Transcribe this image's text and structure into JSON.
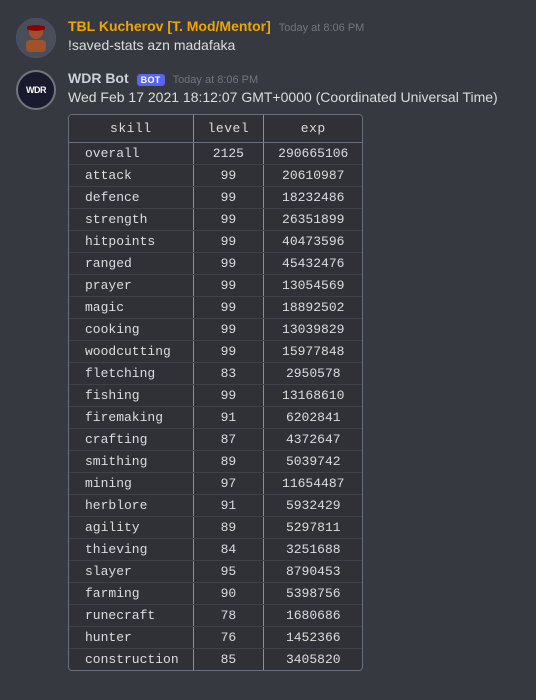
{
  "messages": [
    {
      "id": "msg1",
      "username": "TBL Kucherov [T. Mod/Mentor]",
      "username_color": "#f0a500",
      "timestamp": "Today at 8:06 PM",
      "text": "!saved-stats azn madafaka",
      "is_bot": false,
      "avatar_type": "tbl"
    },
    {
      "id": "msg2",
      "username": "WDR Bot",
      "timestamp": "Today at 8:06 PM",
      "text": "Wed Feb 17 2021 18:12:07 GMT+0000 (Coordinated Universal Time)",
      "is_bot": true,
      "avatar_type": "wdr",
      "time_label": "8:06 PM"
    }
  ],
  "bot_badge": "BOT",
  "table": {
    "headers": [
      "skill",
      "level",
      "exp"
    ],
    "rows": [
      [
        "overall",
        "2125",
        "290665106"
      ],
      [
        "attack",
        "99",
        "20610987"
      ],
      [
        "defence",
        "99",
        "18232486"
      ],
      [
        "strength",
        "99",
        "26351899"
      ],
      [
        "hitpoints",
        "99",
        "40473596"
      ],
      [
        "ranged",
        "99",
        "45432476"
      ],
      [
        "prayer",
        "99",
        "13054569"
      ],
      [
        "magic",
        "99",
        "18892502"
      ],
      [
        "cooking",
        "99",
        "13039829"
      ],
      [
        "woodcutting",
        "99",
        "15977848"
      ],
      [
        "fletching",
        "83",
        "2950578"
      ],
      [
        "fishing",
        "99",
        "13168610"
      ],
      [
        "firemaking",
        "91",
        "6202841"
      ],
      [
        "crafting",
        "87",
        "4372647"
      ],
      [
        "smithing",
        "89",
        "5039742"
      ],
      [
        "mining",
        "97",
        "11654487"
      ],
      [
        "herblore",
        "91",
        "5932429"
      ],
      [
        "agility",
        "89",
        "5297811"
      ],
      [
        "thieving",
        "84",
        "3251688"
      ],
      [
        "slayer",
        "95",
        "8790453"
      ],
      [
        "farming",
        "90",
        "5398756"
      ],
      [
        "runecraft",
        "78",
        "1680686"
      ],
      [
        "hunter",
        "76",
        "1452366"
      ],
      [
        "construction",
        "85",
        "3405820"
      ]
    ]
  }
}
